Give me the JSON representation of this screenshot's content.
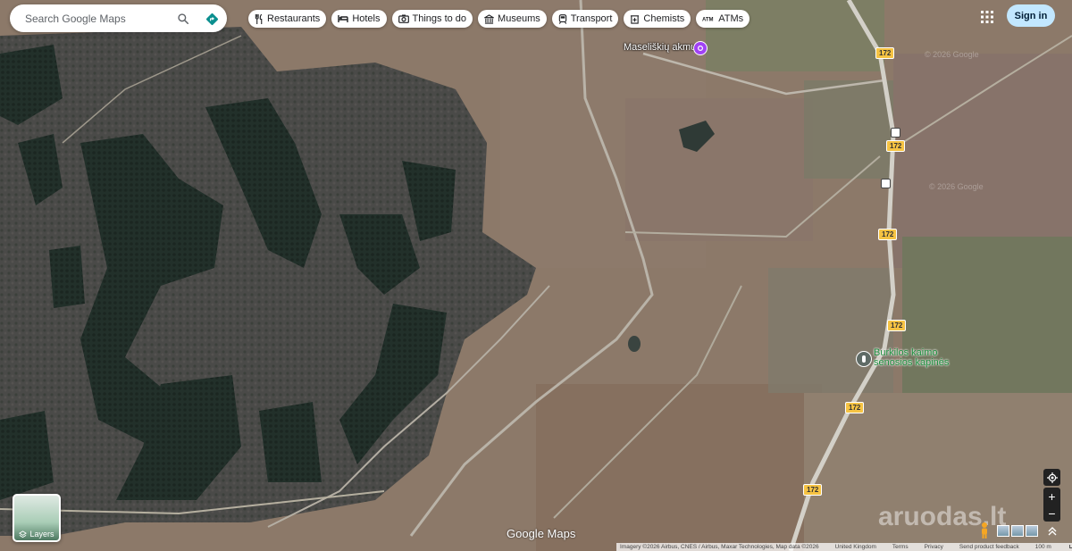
{
  "search": {
    "placeholder": "Search Google Maps"
  },
  "icons": {
    "search": "search-icon",
    "directions": "directions-icon",
    "apps": "apps-grid-icon",
    "layers": "layers-icon",
    "location": "my-location-icon"
  },
  "chips": [
    {
      "label": "Restaurants",
      "icon": "fork-knife-icon"
    },
    {
      "label": "Hotels",
      "icon": "bed-icon"
    },
    {
      "label": "Things to do",
      "icon": "camera-icon"
    },
    {
      "label": "Museums",
      "icon": "museum-icon"
    },
    {
      "label": "Transport",
      "icon": "train-icon"
    },
    {
      "label": "Chemists",
      "icon": "pharmacy-icon"
    },
    {
      "label": "ATMs",
      "icon": "atm-icon"
    }
  ],
  "account": {
    "signin_label": "Sign in"
  },
  "pois": {
    "stone": {
      "name": "Maseliškių akmuo",
      "color": "#a142f4"
    },
    "cemetery": {
      "line1": "Burkilos kaimo",
      "line2": "senosios kapinės",
      "color": "#1e8e3e"
    }
  },
  "road_shields": [
    "172",
    "172",
    "172",
    "172",
    "172",
    "172"
  ],
  "layers": {
    "label": "Layers"
  },
  "zoom": {
    "in": "+",
    "out": "−"
  },
  "branding": {
    "logo": "Google Maps",
    "watermark": "aruodas.lt",
    "imagery_watermark": "© 2026 Google"
  },
  "footer": {
    "imagery": "Imagery ©2026 Airbus, CNES / Airbus, Maxar Technologies, Map data ©2026",
    "region": "United Kingdom",
    "terms": "Terms",
    "privacy": "Privacy",
    "feedback": "Send product feedback",
    "scale": "100 m"
  },
  "colors": {
    "field": "#8a7766",
    "forest": "#3a3f3a",
    "road": "#c9c6bf",
    "accent": "#c2e7ff"
  }
}
